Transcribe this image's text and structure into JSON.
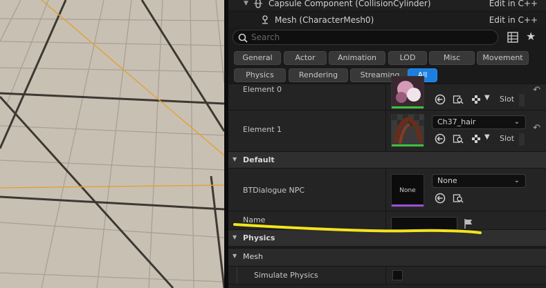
{
  "tree": {
    "capsule_label": "Capsule Component (CollisionCylinder)",
    "capsule_edit": "Edit in C++",
    "mesh_label": "Mesh (CharacterMesh0)",
    "mesh_edit": "Edit in C++"
  },
  "search": {
    "placeholder": "Search"
  },
  "filters": [
    "General",
    "Actor",
    "Animation",
    "LOD",
    "Misc",
    "Movement",
    "Physics",
    "Rendering",
    "Streaming",
    "All"
  ],
  "active_filter": "All",
  "materials": {
    "element0_label": "Element 0",
    "element1_label": "Element 1",
    "element1_value": "Ch37_hair",
    "slot_label": "Slot"
  },
  "default_category": {
    "label": "Default",
    "bt_label": "BTDialogue NPC",
    "bt_thumb_text": "None",
    "bt_value": "None",
    "name_label": "Name",
    "name_value": ""
  },
  "physics_category": {
    "label": "Physics"
  },
  "mesh_category": {
    "label": "Mesh",
    "simulate_label": "Simulate Physics"
  },
  "colors": {
    "accent": "#1b7fe0",
    "grid_line_orange": "#e0a33a",
    "annotation_yellow": "#f2e51c",
    "material_bar_green": "#3fbf3f",
    "bt_bar_purple": "#9a4fd6"
  }
}
